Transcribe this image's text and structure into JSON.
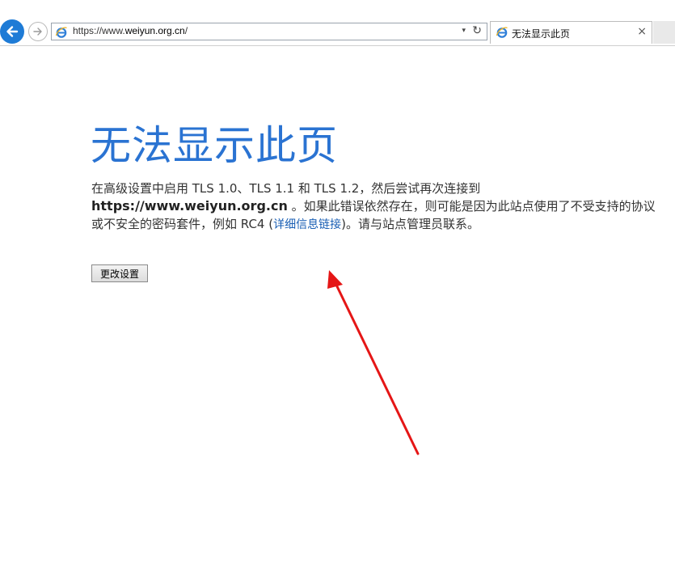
{
  "browser": {
    "url_prefix": "https://www.",
    "url_host": "weiyun.org.cn",
    "url_suffix": "/",
    "tab_title": "无法显示此页",
    "tab_close": "×",
    "refresh_glyph": "↻",
    "dropdown_glyph": "▾"
  },
  "page": {
    "heading": "无法显示此页",
    "message_part1": "在高级设置中启用 TLS 1.0、TLS 1.1 和 TLS 1.2，然后尝试再次连接到",
    "message_host": "https://www.weiyun.org.cn",
    "message_part2": " 。如果此错误依然存在，则可能是因为此站点使用了不受支持的协议或不安全的密码套件，例如 RC4 (",
    "details_link": "详细信息链接",
    "message_part3": ")。请与站点管理员联系。",
    "change_settings_button": "更改设置"
  },
  "colors": {
    "heading": "#2a73d2",
    "back_button": "#1e7bd6",
    "annotation_arrow": "#e51616"
  },
  "icons": [
    "back-arrow-icon",
    "forward-arrow-icon",
    "ie-icon",
    "refresh-icon",
    "close-icon"
  ]
}
